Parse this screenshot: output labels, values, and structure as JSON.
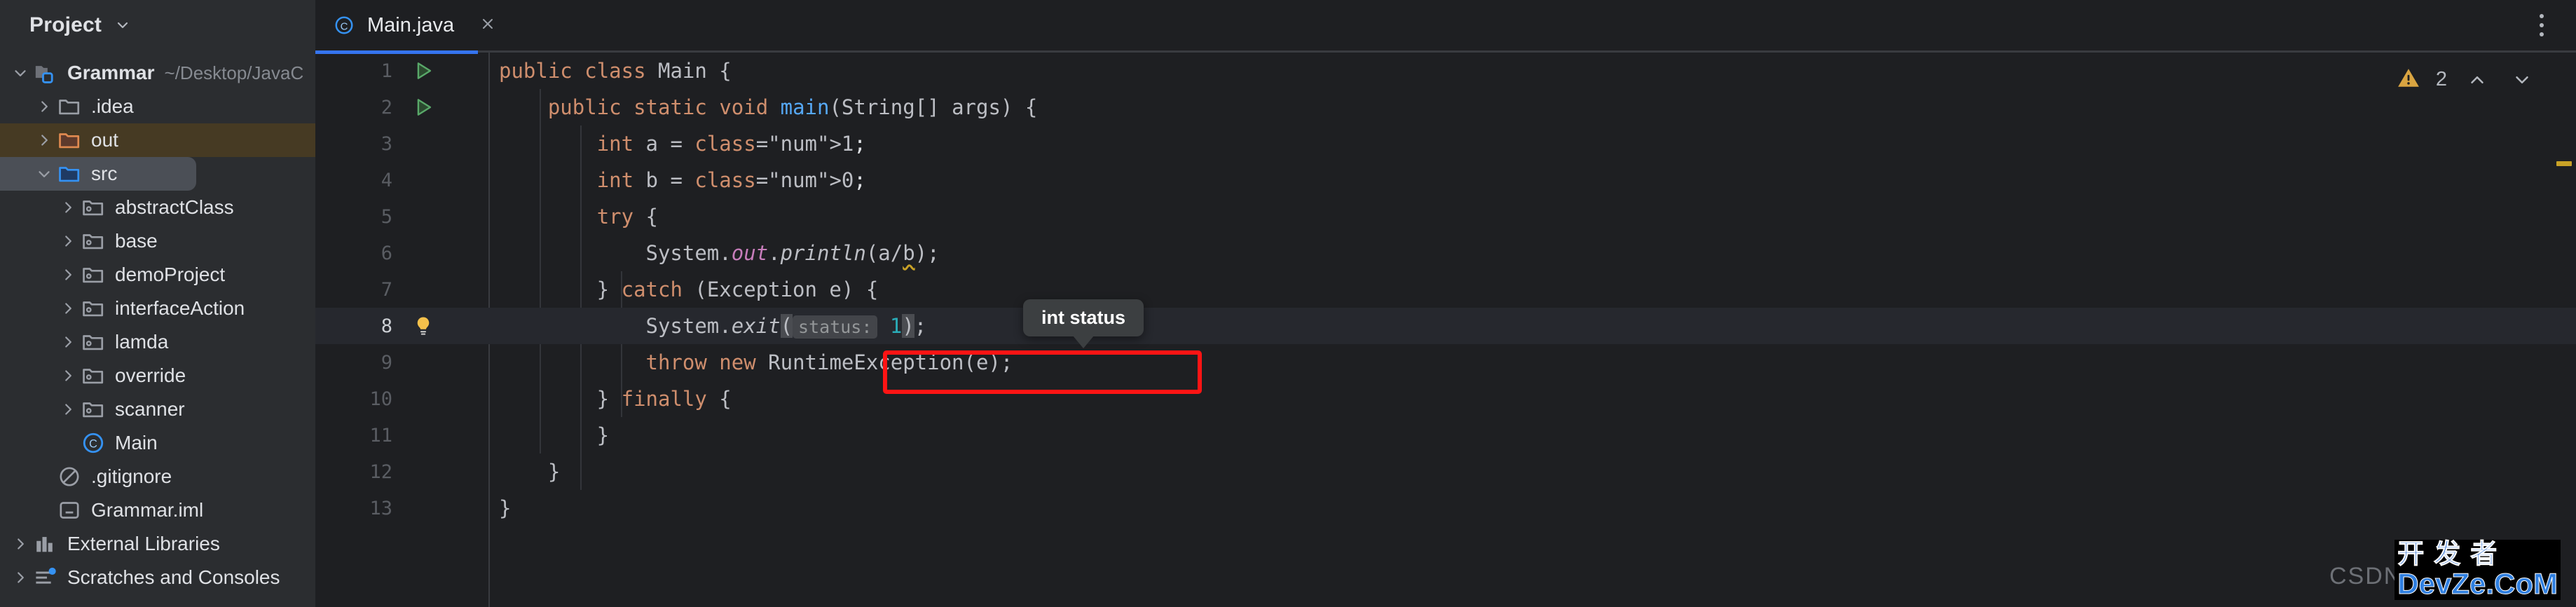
{
  "sidebar": {
    "title": "Project",
    "collapse_icon": "chevron-down-icon",
    "items": [
      {
        "label": "Grammar",
        "path": "~/Desktop/JavaC",
        "icon": "module-folder-icon",
        "arrow": "chevron-down-icon",
        "depth": 0,
        "bold": true,
        "state": "normal"
      },
      {
        "label": ".idea",
        "path": "",
        "icon": "folder-icon",
        "arrow": "chevron-right-icon",
        "depth": 1,
        "bold": false,
        "state": "normal"
      },
      {
        "label": "out",
        "path": "",
        "icon": "folder-excluded-icon",
        "arrow": "chevron-right-icon",
        "depth": 1,
        "bold": false,
        "state": "excluded"
      },
      {
        "label": "src",
        "path": "",
        "icon": "folder-source-icon",
        "arrow": "chevron-down-icon",
        "depth": 1,
        "bold": false,
        "state": "selected"
      },
      {
        "label": "abstractClass",
        "path": "",
        "icon": "package-icon",
        "arrow": "chevron-right-icon",
        "depth": 2,
        "bold": false,
        "state": "normal"
      },
      {
        "label": "base",
        "path": "",
        "icon": "package-icon",
        "arrow": "chevron-right-icon",
        "depth": 2,
        "bold": false,
        "state": "normal"
      },
      {
        "label": "demoProject",
        "path": "",
        "icon": "package-icon",
        "arrow": "chevron-right-icon",
        "depth": 2,
        "bold": false,
        "state": "normal"
      },
      {
        "label": "interfaceAction",
        "path": "",
        "icon": "package-icon",
        "arrow": "chevron-right-icon",
        "depth": 2,
        "bold": false,
        "state": "normal"
      },
      {
        "label": "lamda",
        "path": "",
        "icon": "package-icon",
        "arrow": "chevron-right-icon",
        "depth": 2,
        "bold": false,
        "state": "normal"
      },
      {
        "label": "override",
        "path": "",
        "icon": "package-icon",
        "arrow": "chevron-right-icon",
        "depth": 2,
        "bold": false,
        "state": "normal"
      },
      {
        "label": "scanner",
        "path": "",
        "icon": "package-icon",
        "arrow": "chevron-right-icon",
        "depth": 2,
        "bold": false,
        "state": "normal"
      },
      {
        "label": "Main",
        "path": "",
        "icon": "java-class-icon",
        "arrow": "none",
        "depth": 2,
        "bold": false,
        "state": "normal"
      },
      {
        "label": ".gitignore",
        "path": "",
        "icon": "gitignore-icon",
        "arrow": "none",
        "depth": 1,
        "bold": false,
        "state": "normal"
      },
      {
        "label": "Grammar.iml",
        "path": "",
        "icon": "iml-file-icon",
        "arrow": "none",
        "depth": 1,
        "bold": false,
        "state": "normal"
      },
      {
        "label": "External Libraries",
        "path": "",
        "icon": "libraries-icon",
        "arrow": "chevron-right-icon",
        "depth": 0,
        "bold": false,
        "state": "normal"
      },
      {
        "label": "Scratches and Consoles",
        "path": "",
        "icon": "scratches-icon",
        "arrow": "chevron-right-icon",
        "depth": 0,
        "bold": false,
        "state": "normal"
      }
    ]
  },
  "editor": {
    "tab": {
      "label": "Main.java",
      "icon": "java-class-icon",
      "close_icon": "close-icon"
    },
    "options_icon": "kebab-menu-icon",
    "inspection": {
      "warning_icon": "warning-triangle-icon",
      "warning_count": "2",
      "prev_icon": "chevron-up-icon",
      "next_icon": "chevron-down-icon"
    },
    "current_line": 8,
    "gutter": {
      "run_icon": "run-gutter-icon",
      "intention_icon": "lightbulb-icon"
    },
    "tooltip": {
      "text": "int status"
    },
    "inlay_hint": "status:",
    "lines": [
      {
        "n": "1",
        "gutter": "run",
        "text": "public class Main {"
      },
      {
        "n": "2",
        "gutter": "run",
        "text": "    public static void main(String[] args) {"
      },
      {
        "n": "3",
        "gutter": "",
        "text": "        int a = 1;"
      },
      {
        "n": "4",
        "gutter": "",
        "text": "        int b = 0;"
      },
      {
        "n": "5",
        "gutter": "",
        "text": "        try {"
      },
      {
        "n": "6",
        "gutter": "",
        "text": "            System.out.println(a/b);"
      },
      {
        "n": "7",
        "gutter": "",
        "text": "        } catch (Exception e) {"
      },
      {
        "n": "8",
        "gutter": "bulb",
        "text": "            System.exit( status: 1);"
      },
      {
        "n": "9",
        "gutter": "",
        "text": "            throw new RuntimeException(e);"
      },
      {
        "n": "10",
        "gutter": "",
        "text": "        } finally {"
      },
      {
        "n": "11",
        "gutter": "",
        "text": "        }"
      },
      {
        "n": "12",
        "gutter": "",
        "text": "    }"
      },
      {
        "n": "13",
        "gutter": "",
        "text": "}"
      }
    ]
  },
  "watermark": {
    "prefix": "CSDN",
    "cn": "开发者",
    "en": "DevZe.CoM"
  },
  "colors": {
    "accent": "#3574f0",
    "keyword": "#cf8e6d",
    "number": "#2aacb8",
    "method": "#56a8f5",
    "field": "#c77dbb",
    "warning": "#c9a227",
    "annotation": "#ff1414",
    "sidebar_bg": "#2b2d30",
    "editor_bg": "#1e1f22",
    "excluded_bg": "#463a23",
    "selection_bg": "#4b4f56"
  }
}
